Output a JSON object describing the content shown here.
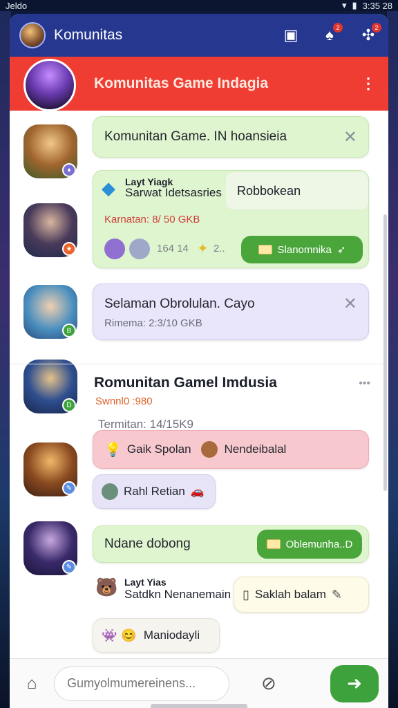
{
  "status": {
    "left": "Jeldo",
    "time": "3:35 28"
  },
  "appbar": {
    "title": "Komunitas",
    "badges": [
      "2",
      "2"
    ]
  },
  "banner": {
    "title": "Komunitas Game Indagia",
    "menu_icon": "kebab-icon"
  },
  "posts": [
    {
      "bubble": "Komunitan Game. IN hoansieia",
      "close_label": "✕"
    },
    {
      "label1": "Layt Yiagk",
      "label2": "Sarwat Idetsasries",
      "chip": "Robbokean",
      "meta": "Karnatan: 8/ 50 GKB",
      "counts": "164 14",
      "count2": "2..",
      "button": "Slanomnika"
    },
    {
      "bubble": "Selaman Obrolulan. Cayo",
      "meta": "Rimema: 2:3/10 GKB",
      "close_label": "✕"
    },
    {
      "title": "Romunitan Gamel Imdusia",
      "sub": "Swnnl0 :980",
      "meta": "Termitan: 14/15K9",
      "menu": "•••"
    },
    {
      "pill1": "Gaik Spolan",
      "pill1b": "Nendeibalal",
      "pill2": "Rahl Retian"
    },
    {
      "bubble": "Ndane dobong",
      "button": "Oblemunha..D"
    },
    {
      "label1": "Layt Yias",
      "label2": "Satdkn Nenanemain",
      "chip": "Saklah balam"
    },
    {
      "bubble": "Maniodayli"
    }
  ],
  "composer": {
    "placeholder": "Gumyolmumereinens..."
  },
  "colors": {
    "appbar": "#26378f",
    "banner": "#ef3d33",
    "send": "#3ea23c"
  }
}
